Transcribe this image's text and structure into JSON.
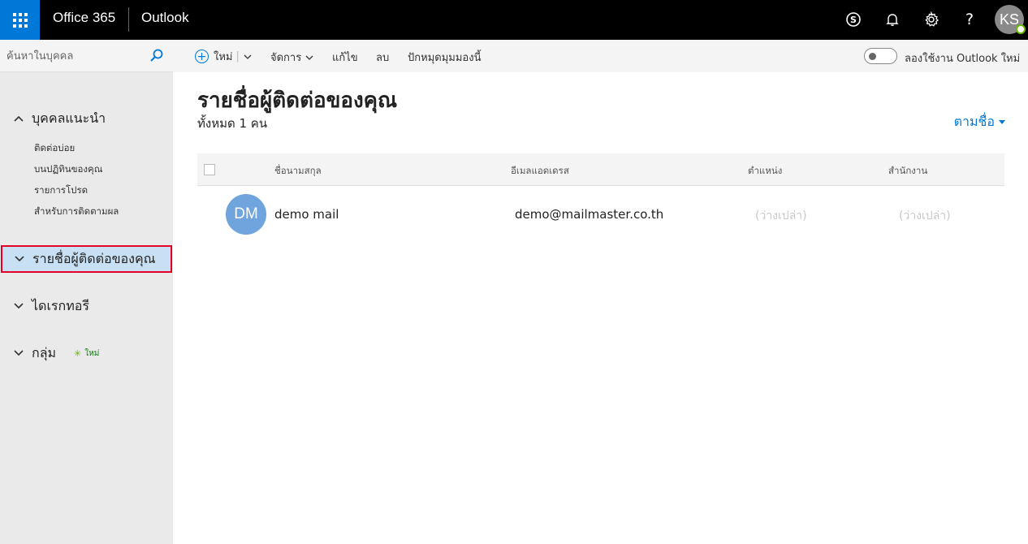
{
  "topbar": {
    "brand": "Office 365",
    "app_name": "Outlook",
    "user_initials": "KS",
    "icons": [
      "app-launcher-icon",
      "skype-icon",
      "bell-icon",
      "gear-icon",
      "help-icon"
    ],
    "help_glyph": "?"
  },
  "sidebar": {
    "search_placeholder": "ค้นหาในบุคคล",
    "suggested": {
      "label": "บุคคลแนะนำ",
      "items": [
        {
          "label": "ติดต่อบ่อย"
        },
        {
          "label": "บนปฏิทินของคุณ"
        },
        {
          "label": "รายการโปรด"
        },
        {
          "label": "สำหรับการติดตามผล"
        }
      ]
    },
    "your_contacts": "รายชื่อผู้ติดต่อของคุณ",
    "directory": "ไดเรกทอรี",
    "groups": "กลุ่ม",
    "groups_new_tag": "ใหม่"
  },
  "commands": {
    "new": "ใหม่",
    "manage": "จัดการ",
    "edit": "แก้ไข",
    "delete": "ลบ",
    "pin": "ปักหมุดมุมมองนี้",
    "try_new_outlook": "ลองใช้งาน Outlook ใหม่"
  },
  "main": {
    "title": "รายชื่อผู้ติดต่อของคุณ",
    "count": "ทั้งหมด 1 คน",
    "sort_label": "ตามชื่อ",
    "columns": [
      "ชื่อนามสกุล",
      "อีเมลแอดเดรส",
      "ตำแหน่ง",
      "สำนักงาน"
    ],
    "contacts": [
      {
        "initials": "DM",
        "name": "demo mail",
        "email": "demo@mailmaster.co.th",
        "position": "(ว่างเปล่า)",
        "office": "(ว่างเปล่า)"
      }
    ]
  },
  "colors": {
    "accent": "#0078d7",
    "topbar_bg": "#000000",
    "sidebar_bg": "#eaeaea",
    "selected_bg": "#c7e0f4",
    "highlight_border": "#e5002a",
    "avatar_bg": "#6fa4dd"
  }
}
